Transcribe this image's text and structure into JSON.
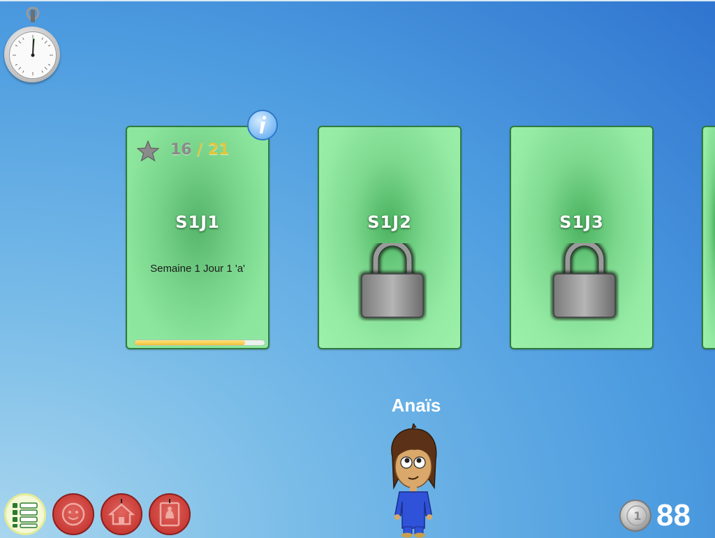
{
  "stopwatch": {
    "icon": "stopwatch-icon"
  },
  "levels": [
    {
      "code": "S1J1",
      "subtitle": "Semaine 1 Jour 1 'a'",
      "stars_current": "16",
      "stars_separator": " / ",
      "stars_total": "21",
      "progress_fraction": 0.85,
      "locked": false
    },
    {
      "code": "S1J2",
      "locked": true
    },
    {
      "code": "S1J3",
      "locked": true
    }
  ],
  "player": {
    "name": "Anaïs"
  },
  "coins": {
    "count": "88",
    "coin_label": "1"
  },
  "toolbar": {
    "list_icon": "list-icon",
    "face_icon": "face-icon",
    "house_icon": "house-icon",
    "book_icon": "book-icon"
  },
  "colors": {
    "card_green": "#95eba4",
    "card_border": "#2f7a3e",
    "progress_yellow": "#f0c13a",
    "button_red": "#c93b36",
    "star_total": "#e4c43a"
  }
}
